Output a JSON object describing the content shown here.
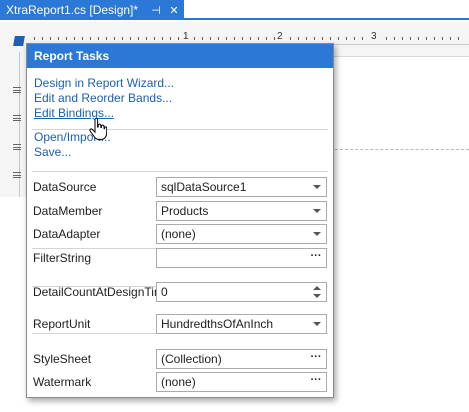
{
  "tab": {
    "title": "XtraReport1.cs [Design]*",
    "pin_glyph": "⊣",
    "close_glyph": "✕"
  },
  "ruler": {
    "labels": [
      "1",
      "2",
      "3"
    ]
  },
  "panel": {
    "title": "Report Tasks",
    "links": [
      "Design in Report Wizard...",
      "Edit and Reorder Bands...",
      "Edit Bindings...",
      "Open/Import...",
      "Save..."
    ],
    "properties": [
      {
        "label": "DataSource",
        "value": "sqlDataSource1",
        "editor": "dropdown"
      },
      {
        "label": "DataMember",
        "value": "Products",
        "editor": "dropdown"
      },
      {
        "label": "DataAdapter",
        "value": "(none)",
        "editor": "dropdown"
      },
      {
        "label": "FilterString",
        "value": "",
        "editor": "ellipsis"
      },
      {
        "label": "DetailCountAtDesignTime",
        "value": "0",
        "editor": "spin"
      },
      {
        "label": "ReportUnit",
        "value": "HundredthsOfAnInch",
        "editor": "dropdown"
      },
      {
        "label": "StyleSheet",
        "value": "(Collection)",
        "editor": "ellipsis"
      },
      {
        "label": "Watermark",
        "value": "(none)",
        "editor": "ellipsis"
      }
    ],
    "ellipsis_glyph": "···"
  },
  "colors": {
    "accent": "#2b78d6",
    "link": "#1a5fb4"
  },
  "icons": [
    "pin-icon",
    "tab-close-icon",
    "chevron-down-icon",
    "spin-up-icon",
    "spin-down-icon",
    "hand-cursor-icon"
  ]
}
